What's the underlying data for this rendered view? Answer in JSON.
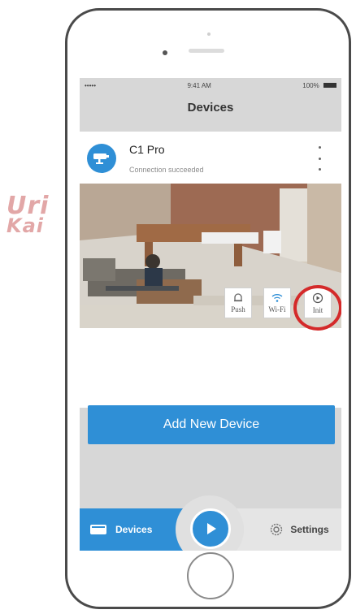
{
  "status_bar": {
    "carrier": "••••• ",
    "time": "9:41 AM",
    "battery": "100%"
  },
  "nav": {
    "title": "Devices"
  },
  "device": {
    "name": "C1 Pro",
    "status": "Connection succeeded",
    "icon": "camera-icon"
  },
  "controls": [
    {
      "label": "Push",
      "icon": "push-icon"
    },
    {
      "label": "Wi-Fi",
      "icon": "wifi-icon"
    },
    {
      "label": "Init",
      "icon": "init-icon"
    }
  ],
  "add_button": {
    "label": "Add New Device"
  },
  "tabs": {
    "devices": {
      "label": "Devices",
      "icon": "devices-icon"
    },
    "play": {
      "icon": "play-icon"
    },
    "settings": {
      "label": "Settings",
      "icon": "gear-icon"
    }
  },
  "watermark": {
    "line1": "Uri",
    "line2": "Kai"
  },
  "colors": {
    "accent": "#2f8fd6",
    "highlight": "#d42a2a",
    "screen_bg": "#d7d7d7"
  }
}
